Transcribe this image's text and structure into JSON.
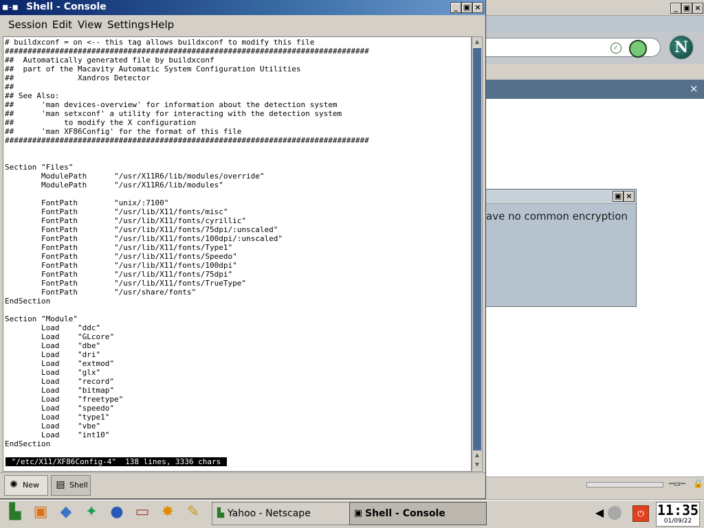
{
  "console": {
    "title": "Shell - Console",
    "sys_icon": "■-■",
    "menu": [
      "Session",
      "Edit",
      "View",
      "Settings",
      "Help"
    ],
    "terminal_lines": [
      "# buildxconf = on <-- this tag allows buildxconf to modify this file",
      "################################################################################",
      "##  Automatically generated file by buildxconf",
      "##  part of the Macavity Automatic System Configuration Utilities",
      "##              Xandros Detector",
      "##",
      "## See Also:",
      "##      'man devices-overview' for information about the detection system",
      "##      'man setxconf' a utility for interacting with the detection system",
      "##           to modify the X configuration",
      "##      'man XF86Config' for the format of this file",
      "################################################################################",
      "",
      "",
      "Section \"Files\"",
      "        ModulePath      \"/usr/X11R6/lib/modules/override\"",
      "        ModulePath      \"/usr/X11R6/lib/modules\"",
      "",
      "        FontPath        \"unix/:7100\"",
      "        FontPath        \"/usr/lib/X11/fonts/misc\"",
      "        FontPath        \"/usr/lib/X11/fonts/cyrillic\"",
      "        FontPath        \"/usr/lib/X11/fonts/75dpi/:unscaled\"",
      "        FontPath        \"/usr/lib/X11/fonts/100dpi/:unscaled\"",
      "        FontPath        \"/usr/lib/X11/fonts/Type1\"",
      "        FontPath        \"/usr/lib/X11/fonts/Speedo\"",
      "        FontPath        \"/usr/lib/X11/fonts/100dpi\"",
      "        FontPath        \"/usr/lib/X11/fonts/75dpi\"",
      "        FontPath        \"/usr/lib/X11/fonts/TrueType\"",
      "        FontPath        \"/usr/share/fonts\"",
      "EndSection",
      "",
      "Section \"Module\"",
      "        Load    \"ddc\"",
      "        Load    \"GLcore\"",
      "        Load    \"dbe\"",
      "        Load    \"dri\"",
      "        Load    \"extmod\"",
      "        Load    \"glx\"",
      "        Load    \"record\"",
      "        Load    \"bitmap\"",
      "        Load    \"freetype\"",
      "        Load    \"speedo\"",
      "        Load    \"type1\"",
      "        Load    \"vbe\"",
      "        Load    \"int10\"",
      "EndSection"
    ],
    "status_line": " \"/etc/X11/XF86Config-4\"  138 lines, 3336 chars ",
    "tabs": [
      {
        "label": "New",
        "icon": "new-session-icon"
      },
      {
        "label": "Shell",
        "icon": "shell-icon"
      }
    ]
  },
  "netscape": {
    "dialog_text": "ave no common encryption",
    "logo_letter": "N",
    "close_symbol": "×"
  },
  "taskbar": {
    "launchers": [
      {
        "name": "xandros-menu",
        "glyph": "▙",
        "color": "#2a7a2a"
      },
      {
        "name": "lifejacket",
        "glyph": "▣",
        "color": "#e07010"
      },
      {
        "name": "cube",
        "glyph": "◆",
        "color": "#3a74c4"
      },
      {
        "name": "runner",
        "glyph": "✦",
        "color": "#18a050"
      },
      {
        "name": "globe",
        "glyph": "●",
        "color": "#2a5ab8"
      },
      {
        "name": "drive",
        "glyph": "▭",
        "color": "#b04030"
      },
      {
        "name": "sprinter",
        "glyph": "✸",
        "color": "#e08a00"
      },
      {
        "name": "brush",
        "glyph": "✎",
        "color": "#c89a20"
      }
    ],
    "tasks": [
      {
        "label": "Yahoo - Netscape",
        "icon": "netscape-icon"
      },
      {
        "label": "Shell - Console",
        "icon": "console-icon"
      }
    ],
    "clock_time": "11:35",
    "clock_date": "01/09/22"
  }
}
